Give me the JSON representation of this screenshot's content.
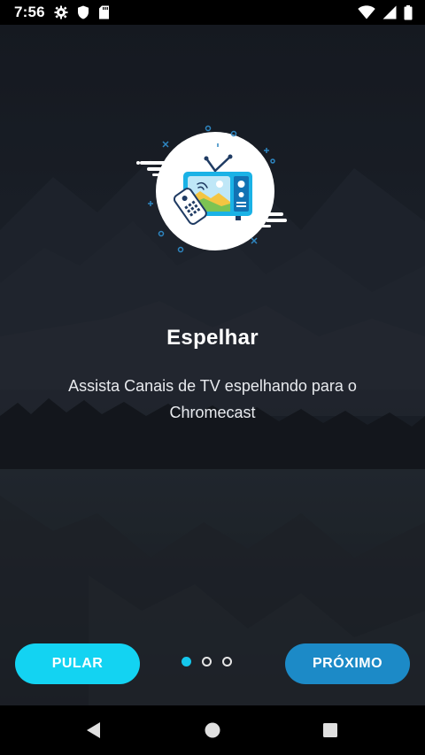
{
  "status_bar": {
    "time": "7:56",
    "icons": [
      "gear-icon",
      "shield-icon",
      "sd-card-icon",
      "wifi-icon",
      "signal-icon",
      "battery-icon"
    ]
  },
  "onboarding": {
    "illustration": "tv-mirroring-illustration",
    "title": "Espelhar",
    "description": "Assista Canais de TV espelhando para o Chromecast",
    "page_indicator": {
      "total": 3,
      "current": 1
    },
    "skip_label": "PULAR",
    "next_label": "PRÓXIMO"
  },
  "nav_bar": {
    "icons": [
      "back-icon",
      "home-icon",
      "recents-icon"
    ]
  },
  "colors": {
    "skip_button": "#13d3f2",
    "next_button": "#1c8ac7",
    "active_dot": "#15c7ec",
    "background": "#1b2029"
  }
}
